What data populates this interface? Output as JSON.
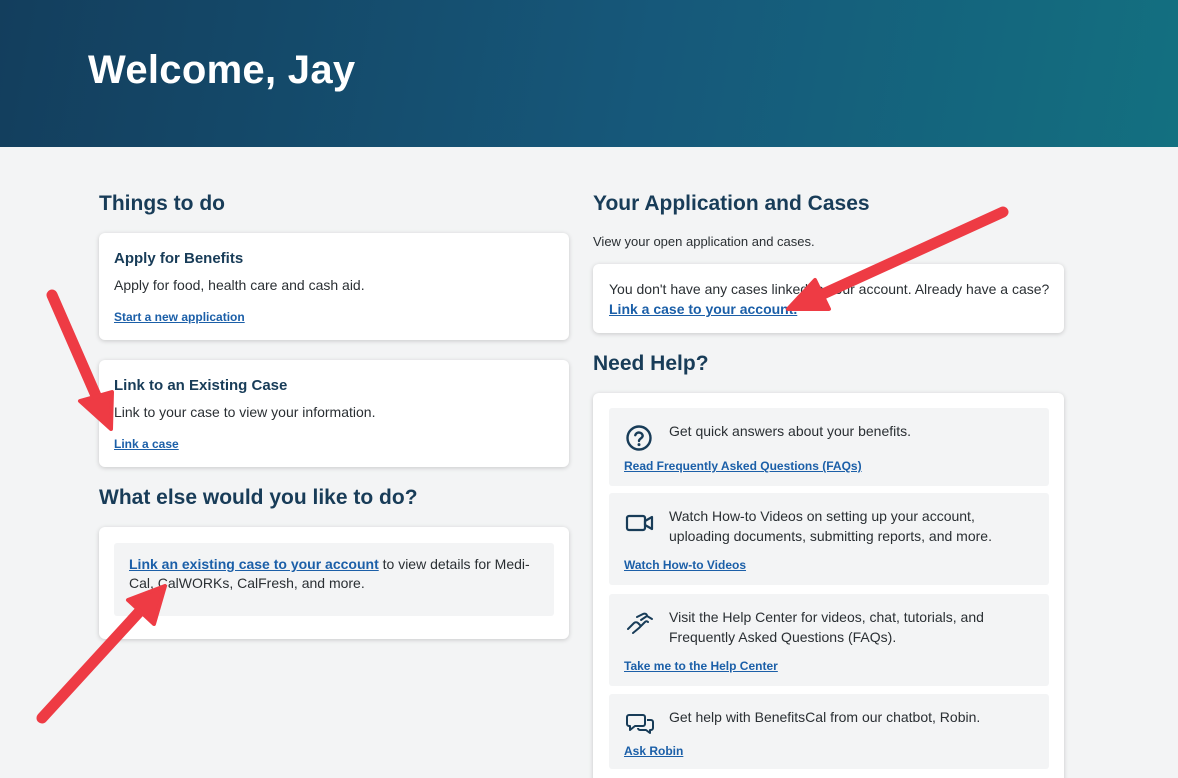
{
  "header": {
    "title": "Welcome, Jay"
  },
  "things_to_do": {
    "heading": "Things to do",
    "apply": {
      "title": "Apply for Benefits",
      "text": "Apply for food, health care and cash aid.",
      "link": "Start a new application"
    },
    "link_case": {
      "title": "Link to an Existing Case",
      "text": "Link to your case to view your information.",
      "link": "Link a case"
    }
  },
  "what_else": {
    "heading": "What else would you like to do?",
    "link": "Link an existing case to your account",
    "text_after": " to view details for Medi-Cal, CalWORKs, CalFresh, and more."
  },
  "applications": {
    "heading": "Your Application and Cases",
    "subtext": "View your open application and cases.",
    "no_cases_text": "You don't have any cases linked to your account. Already have a case?",
    "link": "Link a case to your account."
  },
  "need_help": {
    "heading": "Need Help?",
    "items": [
      {
        "icon": "question-circle-icon",
        "text": "Get quick answers about your benefits.",
        "link": "Read Frequently Asked Questions (FAQs)"
      },
      {
        "icon": "video-camera-icon",
        "text": "Watch How-to Videos on setting up your account, uploading documents, submitting reports, and more.",
        "link": "Watch How-to Videos"
      },
      {
        "icon": "helping-hand-icon",
        "text": "Visit the Help Center for videos, chat, tutorials, and Frequently Asked Questions (FAQs).",
        "link": "Take me to the Help Center"
      },
      {
        "icon": "chat-bubbles-icon",
        "text": "Get help with BenefitsCal from our chatbot, Robin.",
        "link": "Ask Robin"
      }
    ]
  },
  "colors": {
    "header_start": "#133e5d",
    "header_end": "#137080",
    "heading": "#183c58",
    "link": "#1b5fa8",
    "annotation_arrow": "#ee3b44"
  }
}
